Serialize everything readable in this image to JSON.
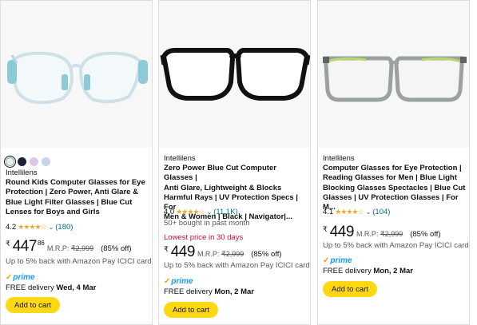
{
  "products": [
    {
      "swatches": [
        "#e9eef0",
        "#1b2233",
        "#d9c9e6",
        "#c9d3ea"
      ],
      "brand": "Intellilens",
      "title_lines": [
        "Round Kids Computer Glasses for Eye",
        "Protection | Zero Power, Anti Glare &",
        "Blue Light Filter Glasses | Blue Cut",
        "Lenses for Boys and Girls"
      ],
      "rating_value": "4.2",
      "stars": "★★★★☆",
      "rating_count": "(180)",
      "currency": "₹",
      "price_whole": "447",
      "price_fraction": "86",
      "mrp_label": "M.R.P:",
      "mrp_value": "₹2,999",
      "discount": "(85% off)",
      "cashback": "Up to 5% back with Amazon Pay ICICI card",
      "prime_label": "prime",
      "delivery_prefix": "FREE delivery",
      "delivery_date": "Wed, 4 Mar",
      "button_label": "Add to cart"
    },
    {
      "brand": "Intellilens",
      "title_lines": [
        "Zero Power Blue Cut Computer Glasses |",
        "Anti Glare, Lightweight & Blocks",
        "Harmful Rays | UV Protection Specs | For",
        "Men & Women | Black | Navigator|..."
      ],
      "rating_value": "4.0",
      "stars": "★★★★☆",
      "rating_count": "(11.1K)",
      "bought": "50+ bought in past month",
      "deal": "Lowest price in 30 days",
      "currency": "₹",
      "price_whole": "449",
      "mrp_label": "M.R.P:",
      "mrp_value": "₹2,999",
      "discount": "(85% off)",
      "cashback": "Up to 5% back with Amazon Pay ICICI card",
      "prime_label": "prime",
      "delivery_prefix": "FREE delivery",
      "delivery_date": "Mon, 2 Mar",
      "button_label": "Add to cart"
    },
    {
      "brand": "Intellilens",
      "title_lines": [
        "Computer Glasses for Eye Protection |",
        "Reading Glasses for Men | Blue Light",
        "Blocking Glasses Spectacles | Blue Cut",
        "Glasses | UV Protection Glasses | For M..."
      ],
      "rating_value": "4.1",
      "stars": "★★★★☆",
      "rating_count": "(104)",
      "currency": "₹",
      "price_whole": "449",
      "mrp_label": "M.R.P:",
      "mrp_value": "₹2,999",
      "discount": "(85% off)",
      "cashback": "Up to 5% back with Amazon Pay ICICI card",
      "prime_label": "prime",
      "delivery_prefix": "FREE delivery",
      "delivery_date": "Mon, 2 Mar",
      "button_label": "Add to cart"
    }
  ],
  "colors": {
    "star": "#f5a623",
    "link": "#007185",
    "deal": "#cc0c39",
    "prime": "#1399ff",
    "button": "#ffd814"
  }
}
